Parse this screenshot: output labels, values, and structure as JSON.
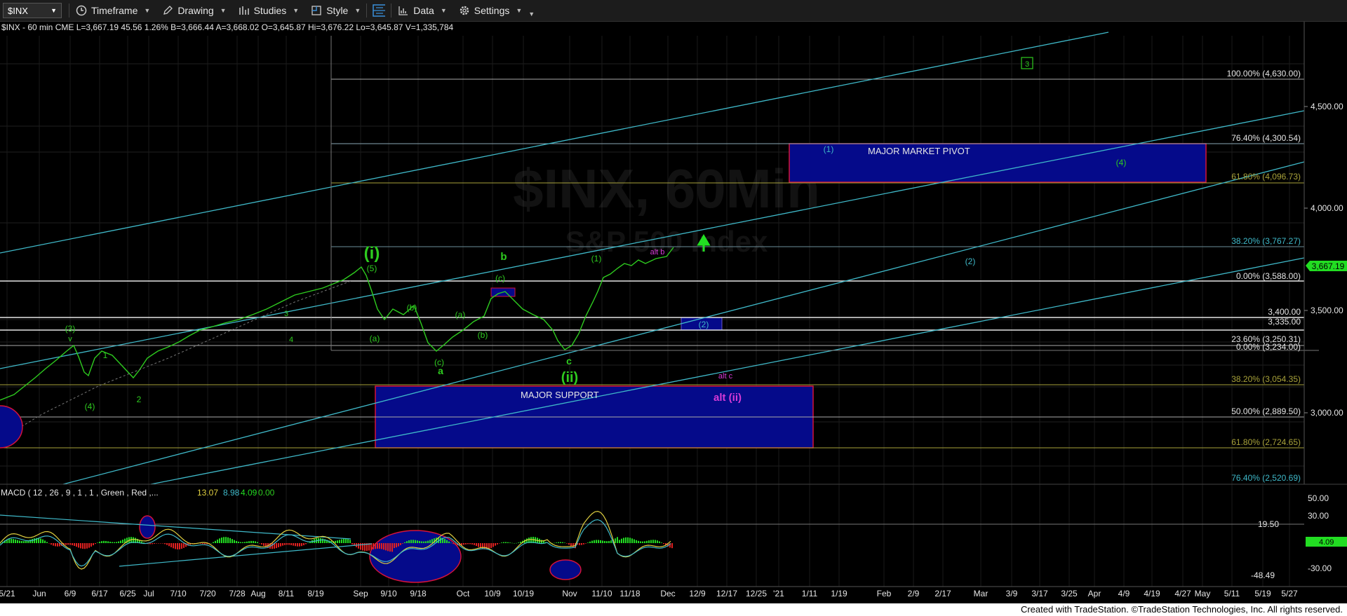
{
  "toolbar": {
    "symbol": "$INX",
    "items": [
      {
        "label": "Timeframe",
        "icon": "clock-icon"
      },
      {
        "label": "Drawing",
        "icon": "pencil-icon"
      },
      {
        "label": "Studies",
        "icon": "studies-icon"
      },
      {
        "label": "Style",
        "icon": "style-icon"
      },
      {
        "label": "",
        "icon": "layout-icon"
      },
      {
        "label": "Data",
        "icon": "data-icon"
      },
      {
        "label": "Settings",
        "icon": "gear-icon"
      }
    ]
  },
  "chart": {
    "header": "$INX - 60 min  CME  L=3,667.19  45.56  1.26%  B=3,666.44  A=3,668.02  O=3,645.87  Hi=3,676.22  Lo=3,645.87  V=1,335,784",
    "watermark_title": "$INX, 60Min",
    "watermark_sub": "S&P 500 Index",
    "last_price_tag": "3,667.19",
    "colors": {
      "price": "#2ecc1f",
      "channel": "#3fb9c9",
      "fib_yellow": "#a8a23a",
      "zone_fill": "#050a8a",
      "zone_border": "#d5123a",
      "tag_green": "#22dd22"
    },
    "price_ticks": [
      "4,500.00",
      "4,000.00",
      "3,500.00",
      "3,000.00"
    ],
    "fib_labels": [
      {
        "text": "100.00% (4,630.00)"
      },
      {
        "text": "76.40% (4,300.54)"
      },
      {
        "text": "61.80% (4,096.73)"
      },
      {
        "text": "38.20% (3,767.27)"
      },
      {
        "text": "0.00% (3,588.00)"
      },
      {
        "text": "3,400.00"
      },
      {
        "text": "3,335.00"
      },
      {
        "text": "23.60% (3,250.31)"
      },
      {
        "text": "0.00% (3,234.00)"
      },
      {
        "text": "38.20% (3,054.35)"
      },
      {
        "text": "50.00% (2,889.50)"
      },
      {
        "text": "61.80% (2,724.65)"
      },
      {
        "text": "76.40% (2,520.69)"
      }
    ],
    "zones": [
      "MAJOR MARKET PIVOT",
      "MAJOR SUPPORT"
    ],
    "wave_labels": [
      {
        "text": "(i)",
        "color": "#2ecc1f"
      },
      {
        "text": "(ii)",
        "color": "#2ecc1f"
      },
      {
        "text": "(5)",
        "color": "#2ecc1f"
      },
      {
        "text": "(3)",
        "color": "#2ecc1f"
      },
      {
        "text": "v",
        "color": "#2ecc1f"
      },
      {
        "text": "1",
        "color": "#2ecc1f"
      },
      {
        "text": "2",
        "color": "#2ecc1f"
      },
      {
        "text": "(4)",
        "color": "#2ecc1f"
      },
      {
        "text": "3",
        "color": "#2ecc1f"
      },
      {
        "text": "4",
        "color": "#2ecc1f"
      },
      {
        "text": "(a)",
        "color": "#2ecc1f"
      },
      {
        "text": "(b)",
        "color": "#2ecc1f"
      },
      {
        "text": "(c)",
        "color": "#2ecc1f"
      },
      {
        "text": "a",
        "color": "#2ecc1f"
      },
      {
        "text": "(a)",
        "color": "#2ecc1f"
      },
      {
        "text": "(b)",
        "color": "#2ecc1f"
      },
      {
        "text": "(c)",
        "color": "#2ecc1f"
      },
      {
        "text": "b",
        "color": "#2ecc1f"
      },
      {
        "text": "c",
        "color": "#2ecc1f"
      },
      {
        "text": "(1)",
        "color": "#2ecc1f"
      },
      {
        "text": "alt b",
        "color": "#d63ad6"
      },
      {
        "text": "alt c",
        "color": "#d63ad6"
      },
      {
        "text": "alt (ii)",
        "color": "#d63ad6"
      },
      {
        "text": "(2)",
        "color": "#3fb9c9"
      },
      {
        "text": "(1)",
        "color": "#3fb9c9"
      },
      {
        "text": "(2)",
        "color": "#3fb9c9"
      },
      {
        "text": "(4)",
        "color": "#2ecc1f"
      },
      {
        "text": "3",
        "color": "#2ecc1f"
      }
    ],
    "macd": {
      "header": "MACD ( 12 , 26 , 9 , 1 , 1 , Green , Red ,...",
      "values": [
        "13.07",
        "8.98",
        "4.09",
        "0.00"
      ],
      "value_colors": [
        "#e0d040",
        "#3fb9c9",
        "#22dd22",
        "#2ecc1f"
      ],
      "ticks": [
        "50.00",
        "30.00",
        "-30.00"
      ],
      "level_label": "19.50",
      "min_label": "-48.49",
      "tag": "4.09"
    },
    "x_labels": [
      "5/21",
      "Jun",
      "6/9",
      "6/17",
      "6/25",
      "Jul",
      "7/10",
      "7/20",
      "7/28",
      "Aug",
      "8/11",
      "8/19",
      "Sep",
      "9/10",
      "9/18",
      "Oct",
      "10/9",
      "10/19",
      "Nov",
      "11/10",
      "11/18",
      "Dec",
      "12/9",
      "12/17",
      "12/25",
      "'21",
      "1/11",
      "1/19",
      "Feb",
      "2/9",
      "2/17",
      "Mar",
      "3/9",
      "3/17",
      "3/25",
      "Apr",
      "4/9",
      "4/19",
      "4/27",
      "May",
      "5/11",
      "5/19",
      "5/27"
    ]
  },
  "footer": "Created with TradeStation. ©TradeStation Technologies, Inc. All rights reserved."
}
